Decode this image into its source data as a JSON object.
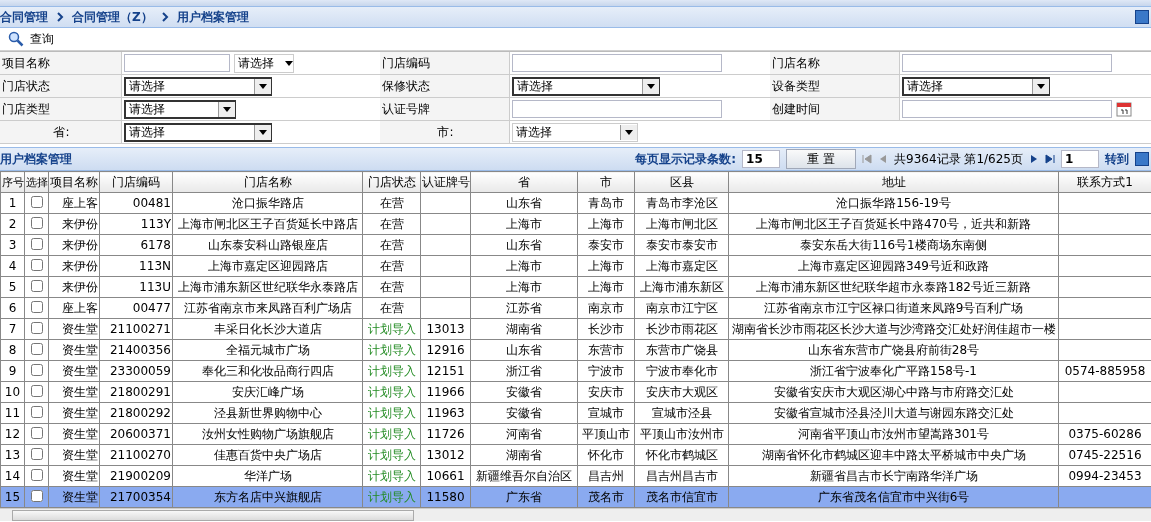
{
  "breadcrumb": [
    "合同管理",
    "合同管理（Z）",
    "用户档案管理"
  ],
  "toolbar": {
    "query_button": "查询"
  },
  "filters": [
    {
      "label": "项目名称",
      "kind": "text-select",
      "select": "请选择"
    },
    {
      "label": "门店编码",
      "kind": "text"
    },
    {
      "label": "门店名称",
      "kind": "text"
    },
    {
      "label": "门店状态",
      "kind": "select",
      "select": "请选择"
    },
    {
      "label": "保修状态",
      "kind": "select",
      "select": "请选择"
    },
    {
      "label": "设备类型",
      "kind": "select",
      "select": "请选择"
    },
    {
      "label": "门店类型",
      "kind": "select-short",
      "select": "请选择"
    },
    {
      "label": "认证号牌",
      "kind": "text"
    },
    {
      "label": "创建时间",
      "kind": "date"
    },
    {
      "label": "省:",
      "kind": "select",
      "select": "请选择"
    },
    {
      "label": "市:",
      "kind": "plain-select",
      "select": "请选择"
    }
  ],
  "grid": {
    "title": "用户档案管理",
    "page_size_label": "每页显示记录条数:",
    "page_size": "15",
    "reset_button": "重 置",
    "record_info": "共9364记录 第1/625页",
    "page_input": "1",
    "goto_link": "转到",
    "columns": [
      "序号",
      "选择",
      "项目名称",
      "门店编码",
      "门店名称",
      "门店状态",
      "认证牌号",
      "省",
      "市",
      "区县",
      "地址",
      "联系方式1"
    ],
    "rows": [
      {
        "no": "1",
        "checked": false,
        "selected": false,
        "project": "座上客",
        "code": "00481",
        "name": "沧口振华路店",
        "status": "在营",
        "kind": "active",
        "plate": "",
        "province": "山东省",
        "city": "青岛市",
        "district": "青岛市李沧区",
        "address": "沧口振华路156-19号",
        "contact": ""
      },
      {
        "no": "2",
        "checked": false,
        "selected": false,
        "project": "来伊份",
        "code": "113Y",
        "name": "上海市闸北区王子百货延长中路店",
        "status": "在营",
        "kind": "active",
        "plate": "",
        "province": "上海市",
        "city": "上海市",
        "district": "上海市闸北区",
        "address": "上海市闸北区王子百货延长中路470号，近共和新路",
        "contact": ""
      },
      {
        "no": "3",
        "checked": false,
        "selected": false,
        "project": "来伊份",
        "code": "6178",
        "name": "山东泰安科山路银座店",
        "status": "在营",
        "kind": "active",
        "plate": "",
        "province": "山东省",
        "city": "泰安市",
        "district": "泰安市泰安市",
        "address": "泰安东岳大街116号1楼商场东南侧",
        "contact": ""
      },
      {
        "no": "4",
        "checked": false,
        "selected": false,
        "project": "来伊份",
        "code": "113N",
        "name": "上海市嘉定区迎园路店",
        "status": "在营",
        "kind": "active",
        "plate": "",
        "province": "上海市",
        "city": "上海市",
        "district": "上海市嘉定区",
        "address": "上海市嘉定区迎园路349号近和政路",
        "contact": ""
      },
      {
        "no": "5",
        "checked": false,
        "selected": false,
        "project": "来伊份",
        "code": "113U",
        "name": "上海市浦东新区世纪联华永泰路店",
        "status": "在营",
        "kind": "active",
        "plate": "",
        "province": "上海市",
        "city": "上海市",
        "district": "上海市浦东新区",
        "address": "上海市浦东新区世纪联华超市永泰路182号近三新路",
        "contact": ""
      },
      {
        "no": "6",
        "checked": false,
        "selected": false,
        "project": "座上客",
        "code": "00477",
        "name": "江苏省南京市来凤路百利广场店",
        "status": "在营",
        "kind": "active",
        "plate": "",
        "province": "江苏省",
        "city": "南京市",
        "district": "南京市江宁区",
        "address": "江苏省南京市江宁区禄口街道来凤路9号百利广场",
        "contact": ""
      },
      {
        "no": "7",
        "checked": false,
        "selected": false,
        "project": "资生堂",
        "code": "21100271",
        "name": "丰采日化长沙大道店",
        "status": "计划导入",
        "kind": "planned",
        "plate": "13013",
        "province": "湖南省",
        "city": "长沙市",
        "district": "长沙市雨花区",
        "address": "湖南省长沙市雨花区长沙大道与沙湾路交汇处好润佳超市一楼",
        "contact": ""
      },
      {
        "no": "8",
        "checked": false,
        "selected": false,
        "project": "资生堂",
        "code": "21400356",
        "name": "全福元城市广场",
        "status": "计划导入",
        "kind": "planned",
        "plate": "12916",
        "province": "山东省",
        "city": "东营市",
        "district": "东营市广饶县",
        "address": "山东省东营市广饶县府前街28号",
        "contact": ""
      },
      {
        "no": "9",
        "checked": false,
        "selected": false,
        "project": "资生堂",
        "code": "23300059",
        "name": "奉化三和化妆品商行四店",
        "status": "计划导入",
        "kind": "planned",
        "plate": "12151",
        "province": "浙江省",
        "city": "宁波市",
        "district": "宁波市奉化市",
        "address": "浙江省宁波奉化广平路158号-1",
        "contact": "0574-885958"
      },
      {
        "no": "10",
        "checked": false,
        "selected": false,
        "project": "资生堂",
        "code": "21800291",
        "name": "安庆汇峰广场",
        "status": "计划导入",
        "kind": "planned",
        "plate": "11966",
        "province": "安徽省",
        "city": "安庆市",
        "district": "安庆市大观区",
        "address": "安徽省安庆市大观区湖心中路与市府路交汇处",
        "contact": ""
      },
      {
        "no": "11",
        "checked": false,
        "selected": false,
        "project": "资生堂",
        "code": "21800292",
        "name": "泾县新世界购物中心",
        "status": "计划导入",
        "kind": "planned",
        "plate": "11963",
        "province": "安徽省",
        "city": "宣城市",
        "district": "宣城市泾县",
        "address": "安徽省宣城市泾县泾川大道与谢园东路交汇处",
        "contact": ""
      },
      {
        "no": "12",
        "checked": false,
        "selected": false,
        "project": "资生堂",
        "code": "20600371",
        "name": "汝州女性购物广场旗舰店",
        "status": "计划导入",
        "kind": "planned",
        "plate": "11726",
        "province": "河南省",
        "city": "平顶山市",
        "district": "平顶山市汝州市",
        "address": "河南省平顶山市汝州市望嵩路301号",
        "contact": "0375-60286"
      },
      {
        "no": "13",
        "checked": false,
        "selected": false,
        "project": "资生堂",
        "code": "21100270",
        "name": "佳惠百货中央广场店",
        "status": "计划导入",
        "kind": "planned",
        "plate": "13012",
        "province": "湖南省",
        "city": "怀化市",
        "district": "怀化市鹤城区",
        "address": "湖南省怀化市鹤城区迎丰中路太平桥城市中央广场",
        "contact": "0745-22516"
      },
      {
        "no": "14",
        "checked": false,
        "selected": false,
        "project": "资生堂",
        "code": "21900209",
        "name": "华洋广场",
        "status": "计划导入",
        "kind": "planned",
        "plate": "10661",
        "province": "新疆维吾尔自治区",
        "city": "昌吉州",
        "district": "昌吉州昌吉市",
        "address": "新疆省昌吉市长宁南路华洋广场",
        "contact": "0994-23453"
      },
      {
        "no": "15",
        "checked": false,
        "selected": true,
        "project": "资生堂",
        "code": "21700354",
        "name": "东方名店中兴旗舰店",
        "status": "计划导入",
        "kind": "planned",
        "plate": "11580",
        "province": "广东省",
        "city": "茂名市",
        "district": "茂名市信宜市",
        "address": "广东省茂名信宜市中兴街6号",
        "contact": ""
      }
    ]
  }
}
